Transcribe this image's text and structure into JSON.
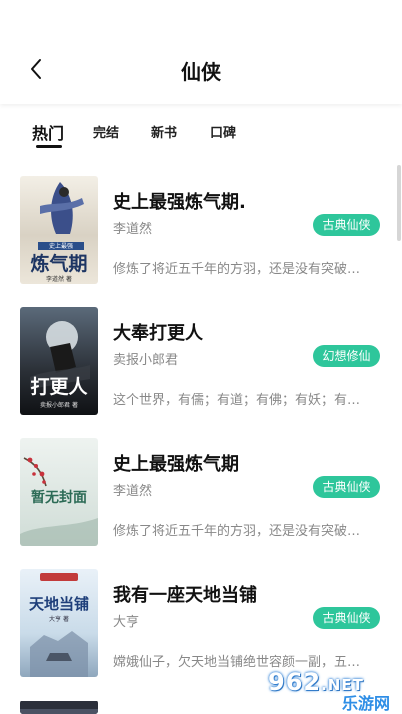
{
  "header": {
    "title": "仙侠"
  },
  "tabs": [
    {
      "label": "热门",
      "active": true
    },
    {
      "label": "完结",
      "active": false
    },
    {
      "label": "新书",
      "active": false
    },
    {
      "label": "口碑",
      "active": false
    }
  ],
  "books": [
    {
      "title": "史上最强炼气期.",
      "author": "李道然",
      "tag": "古典仙侠",
      "desc": "修炼了将近五千年的方羽，还是没有突破…",
      "cover_text": "炼气期",
      "cover_sub": "李道然 著"
    },
    {
      "title": "大奉打更人",
      "author": "卖报小郎君",
      "tag": "幻想修仙",
      "desc": "这个世界，有儒；有道；有佛；有妖；有…",
      "cover_text": "打更人",
      "cover_sub": "卖报小郎君 著"
    },
    {
      "title": "史上最强炼气期",
      "author": "李道然",
      "tag": "古典仙侠",
      "desc": "修炼了将近五千年的方羽，还是没有突破…",
      "cover_text": "暂无封面",
      "cover_sub": ""
    },
    {
      "title": "我有一座天地当铺",
      "author": "大亨",
      "tag": "古典仙侠",
      "desc": "嫦娥仙子，欠天地当铺绝世容颜一副，五…",
      "cover_text": "天地当铺",
      "cover_sub": "大亨 著"
    }
  ],
  "watermark": {
    "number": "962",
    "suffix": ".NET",
    "site": "乐游网"
  },
  "colors": {
    "accent": "#2ec69b",
    "muted_text": "#888888"
  }
}
